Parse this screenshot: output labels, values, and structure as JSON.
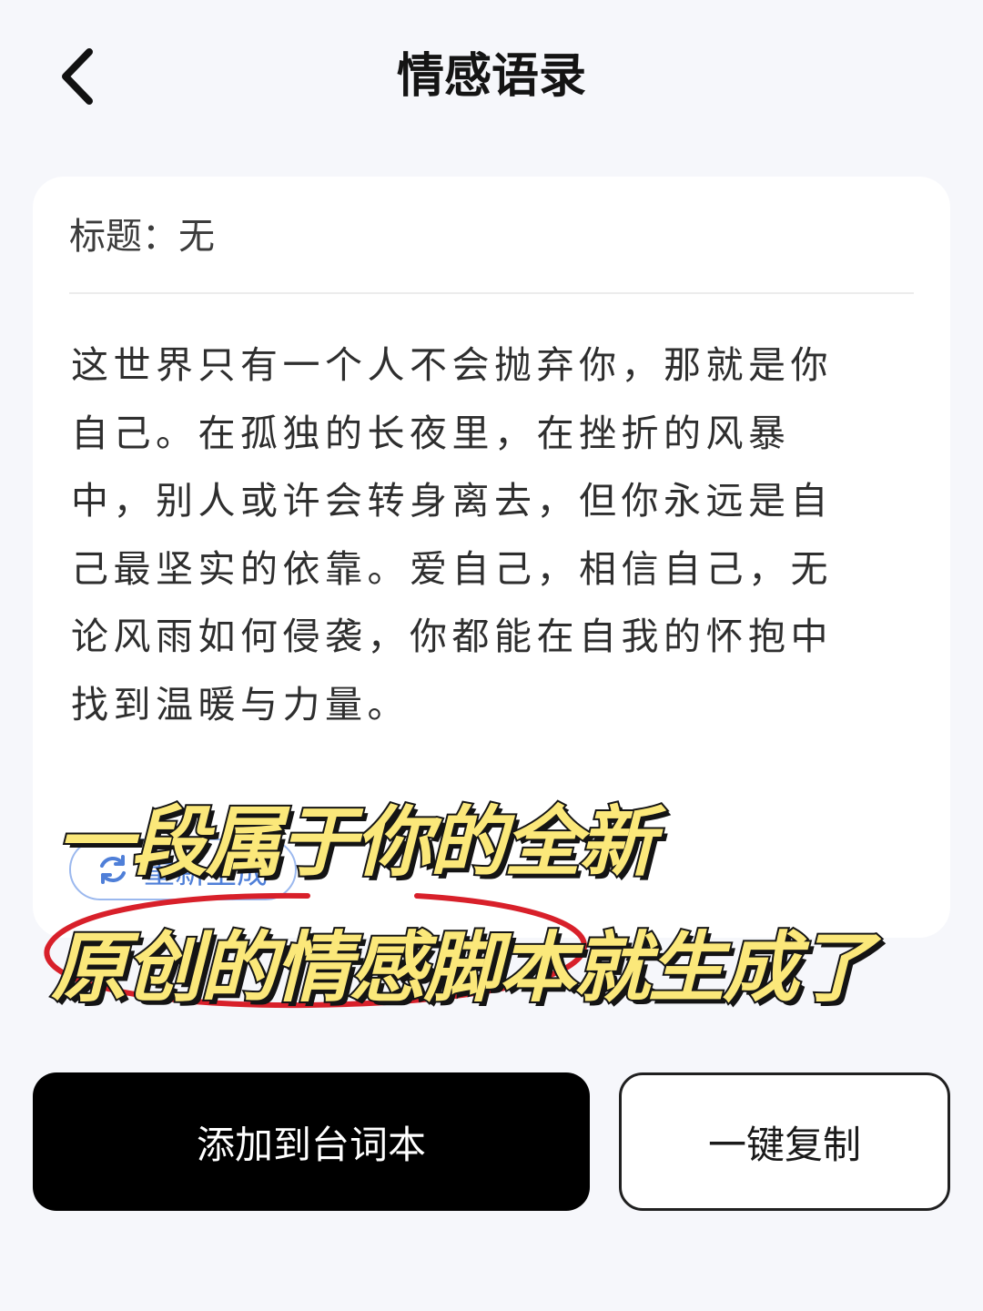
{
  "header": {
    "title": "情感语录",
    "back_icon": "chevron-left-icon"
  },
  "card": {
    "title_label": "标题：无",
    "body_lines": [
      "这世界只有一个人不会抛弃你，那就是你",
      "自己。在孤独的长夜里，在挫折的风暴",
      "中，别人或许会转身离去，但你永远是自",
      "己最坚实的依靠。爱自己，相信自己，无",
      "论风雨如何侵袭，你都能在自我的怀抱中",
      "找到温暖与力量。"
    ],
    "regenerate_label": "重新生成",
    "regenerate_icon": "refresh-icon"
  },
  "overlay": {
    "line1": "一段属于你的全新",
    "line2": "原创的情感脚本就生成了"
  },
  "actions": {
    "primary_label": "添加到台词本",
    "secondary_label": "一键复制"
  },
  "colors": {
    "background": "#f6f7fb",
    "card": "#ffffff",
    "accent_blue": "#4f7fd8",
    "caption_yellow": "#fbe87a",
    "annotation_red": "#d8202a",
    "primary_button": "#000000"
  }
}
